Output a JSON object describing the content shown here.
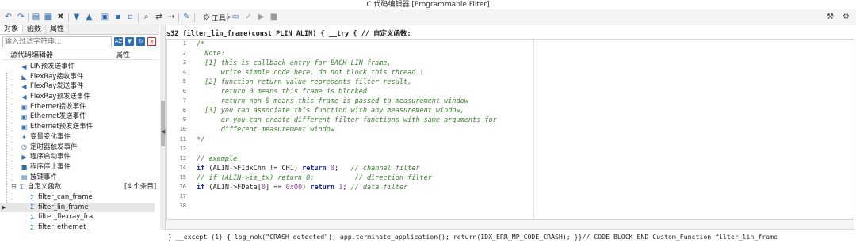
{
  "window": {
    "title": "C 代码编辑器 [Programmable Filter]"
  },
  "toolbar": {
    "tools_label": "工具",
    "icons": [
      "undo-icon",
      "redo-icon",
      "copy-icon",
      "paste-icon",
      "delete-icon",
      "move-down-icon",
      "move-up-icon",
      "new-file-icon",
      "save-icon",
      "save-as-icon",
      "export-icon",
      "search-icon",
      "find-replace-icon",
      "find-next-icon",
      "edit-icon",
      "gear-icon",
      "folder-icon",
      "compile-icon",
      "run-icon",
      "stop-icon",
      "wrench-icon",
      "settings-icon"
    ]
  },
  "left": {
    "tabs": [
      "对象",
      "函数",
      "属性"
    ],
    "filter_placeholder": "输入过滤字符串...",
    "tree_header": {
      "col1": "源代码编辑器",
      "col2": "属性"
    },
    "items": [
      {
        "label": "LIN预发送事件",
        "icon": "send-icon",
        "color": "#2f6db3"
      },
      {
        "label": "FlexRay接收事件",
        "icon": "receive-icon",
        "color": "#2f6db3"
      },
      {
        "label": "FlexRay发送事件",
        "icon": "send-icon",
        "color": "#2f6db3"
      },
      {
        "label": "FlexRay预发送事件",
        "icon": "send-icon",
        "color": "#2f6db3"
      },
      {
        "label": "Ethernet接收事件",
        "icon": "network-icon",
        "color": "#2f6db3"
      },
      {
        "label": "Ethernet发送事件",
        "icon": "network-icon",
        "color": "#2f6db3"
      },
      {
        "label": "Ethernet预发送事件",
        "icon": "network-icon",
        "color": "#2f6db3"
      },
      {
        "label": "变量变化事件",
        "icon": "variable-icon",
        "color": "#2f6db3"
      },
      {
        "label": "定时器触发事件",
        "icon": "timer-icon",
        "color": "#2f6db3"
      },
      {
        "label": "程序启动事件",
        "icon": "start-icon",
        "color": "#2f6db3"
      },
      {
        "label": "程序停止事件",
        "icon": "stop-icon",
        "color": "#2f6db3"
      },
      {
        "label": "按键事件",
        "icon": "keyboard-icon",
        "color": "#2f6db3"
      },
      {
        "label": "自定义函数",
        "icon": "sigma-icon",
        "color": "#2f6db3",
        "extra": "[4 个条目]"
      },
      {
        "label": "filter_can_frame",
        "icon": "sigma-icon",
        "color": "#2f6db3"
      },
      {
        "label": "filter_lin_frame",
        "icon": "sigma-icon",
        "color": "#2f6db3",
        "selected": true
      },
      {
        "label": "filter_flexray_fra",
        "icon": "sigma-icon",
        "color": "#2f6db3"
      },
      {
        "label": "filter_ethernet_",
        "icon": "sigma-icon",
        "color": "#2f6db3"
      }
    ]
  },
  "editor": {
    "header": "s32 filter_lin_frame(const PLIN ALIN) { __try { // 自定义函数:",
    "line_numbers": [
      "1",
      "2",
      "3",
      "4",
      "5",
      "6",
      "7",
      "8",
      "9",
      "10",
      "11",
      "12",
      "13",
      "14",
      "15",
      "16",
      "17",
      "18"
    ],
    "lines": [
      "/*",
      "  Note:",
      "  [1] this is callback entry for EACH LIN frame,",
      "      write simple code here, do not block this thread !",
      "  [2] function return value represents filter result,",
      "      return 0 means this frame is blocked",
      "      return non 0 means this frame is passed to measurement window",
      "  [3] you can associate this function with any measurement window,",
      "      or you can create different filter functions with same arguments for",
      "      different measurement window",
      "*/",
      "",
      "// example",
      "if (ALIN->FIdxChn != CH1) return 0;   // channel filter",
      "// if (ALIN->is_tx) return 0;          // direction filter",
      "if (ALIN->FData[0] == 0x00) return 1; // data filter",
      "",
      ""
    ],
    "footer": "} __except (1) { log_nok(\"CRASH detected\"); app.terminate_application(); return(IDX_ERR_MP_CODE_CRASH); }}// CODE BLOCK END Custom_Function filter_lin_frame"
  },
  "colors": {
    "accent": "#2c6fb5",
    "comment": "#3a7d2f",
    "keyword": "#1a2aa0",
    "number": "#8f3ca1"
  }
}
